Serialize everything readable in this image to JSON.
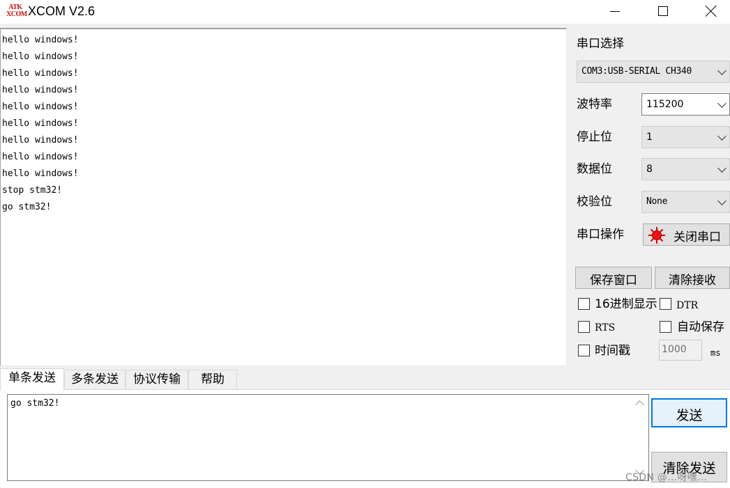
{
  "window": {
    "logo_top": "ATK",
    "logo_bottom": "XCOM",
    "title": "XCOM V2.6"
  },
  "receive": {
    "lines": [
      "hello windows!",
      "hello windows!",
      "hello windows!",
      "hello windows!",
      "hello windows!",
      "hello windows!",
      "hello windows!",
      "hello windows!",
      "hello windows!",
      "stop stm32!",
      "go stm32!"
    ]
  },
  "panel": {
    "port_label": "串口选择",
    "port_value": "COM3:USB-SERIAL CH340",
    "baud_label": "波特率",
    "baud_value": "115200",
    "stop_label": "停止位",
    "stop_value": "1",
    "data_label": "数据位",
    "data_value": "8",
    "parity_label": "校验位",
    "parity_value": "None",
    "op_label": "串口操作",
    "close_port": "关闭串口",
    "save_window": "保存窗口",
    "clear_receive": "清除接收",
    "hex_display": "16进制显示",
    "dtr": "DTR",
    "rts": "RTS",
    "auto_save": "自动保存",
    "timestamp": "时间戳",
    "interval_value": "1000",
    "interval_unit": "ms"
  },
  "tabs": [
    "单条发送",
    "多条发送",
    "协议传输",
    "帮助"
  ],
  "send": {
    "text": "go stm32!",
    "send_button": "发送",
    "clear_send": "清除发送"
  },
  "watermark": "CSDN @…呀嘿…"
}
